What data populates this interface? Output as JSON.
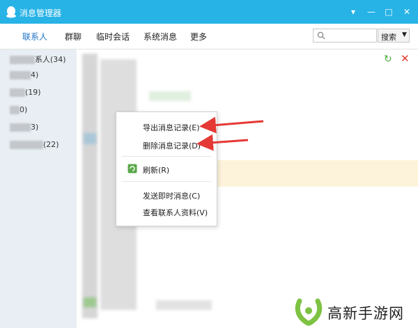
{
  "window": {
    "title": "消息管理器",
    "controls": [
      "▾",
      "—",
      "□",
      "✕"
    ]
  },
  "nav": {
    "tabs": [
      {
        "label": "联系人",
        "active": true
      },
      {
        "label": "群聊",
        "active": false
      },
      {
        "label": "临时会话",
        "active": false
      },
      {
        "label": "系统消息",
        "active": false
      },
      {
        "label": "更多",
        "active": false
      }
    ],
    "search_placeholder": "",
    "search_button": "搜索"
  },
  "groups": [
    {
      "label": "系人(34)"
    },
    {
      "label": "4)"
    },
    {
      "label": "(19)"
    },
    {
      "label": "0)"
    },
    {
      "label": "3)"
    },
    {
      "label": "(22)"
    }
  ],
  "context_menu": {
    "items": [
      {
        "label": "导出消息记录(E)"
      },
      {
        "label": "删除消息记录(D)"
      },
      {
        "label": "刷新(R)"
      },
      {
        "label": "发送即时消息(C)"
      },
      {
        "label": "查看联系人资料(V)"
      }
    ]
  },
  "colors": {
    "titlebar": "#27b3e6",
    "active_tab": "#1e73c8",
    "arrow_red": "#e53935",
    "highlight": "#fdf3db"
  },
  "watermark": {
    "text": "高新手游网"
  }
}
